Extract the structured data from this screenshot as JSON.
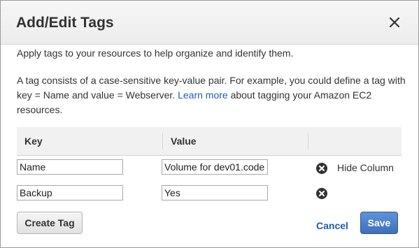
{
  "dialog": {
    "title": "Add/Edit Tags",
    "close_icon": "close-icon"
  },
  "intro": "Apply tags to your resources to help organize and identify them.",
  "description": {
    "before_link": "A tag consists of a case-sensitive key-value pair. For example, you could define a tag with key = Name and value = Webserver.",
    "link": "Learn more",
    "after_link": "about tagging your Amazon EC2 resources."
  },
  "table": {
    "columns": [
      "Key",
      "Value"
    ],
    "rows": [
      {
        "key": "Name",
        "value": "Volume for dev01.code",
        "remove_icon": "remove-circle-icon"
      },
      {
        "key": "Backup",
        "value": "Yes",
        "remove_icon": "remove-circle-icon"
      }
    ],
    "hide_column_label": "Hide Column"
  },
  "buttons": {
    "create_tag": "Create Tag",
    "cancel": "Cancel",
    "save": "Save"
  },
  "colors": {
    "link": "#1a5fb4",
    "primary_button": "#3f6fba",
    "header_bg": "#efefef"
  }
}
